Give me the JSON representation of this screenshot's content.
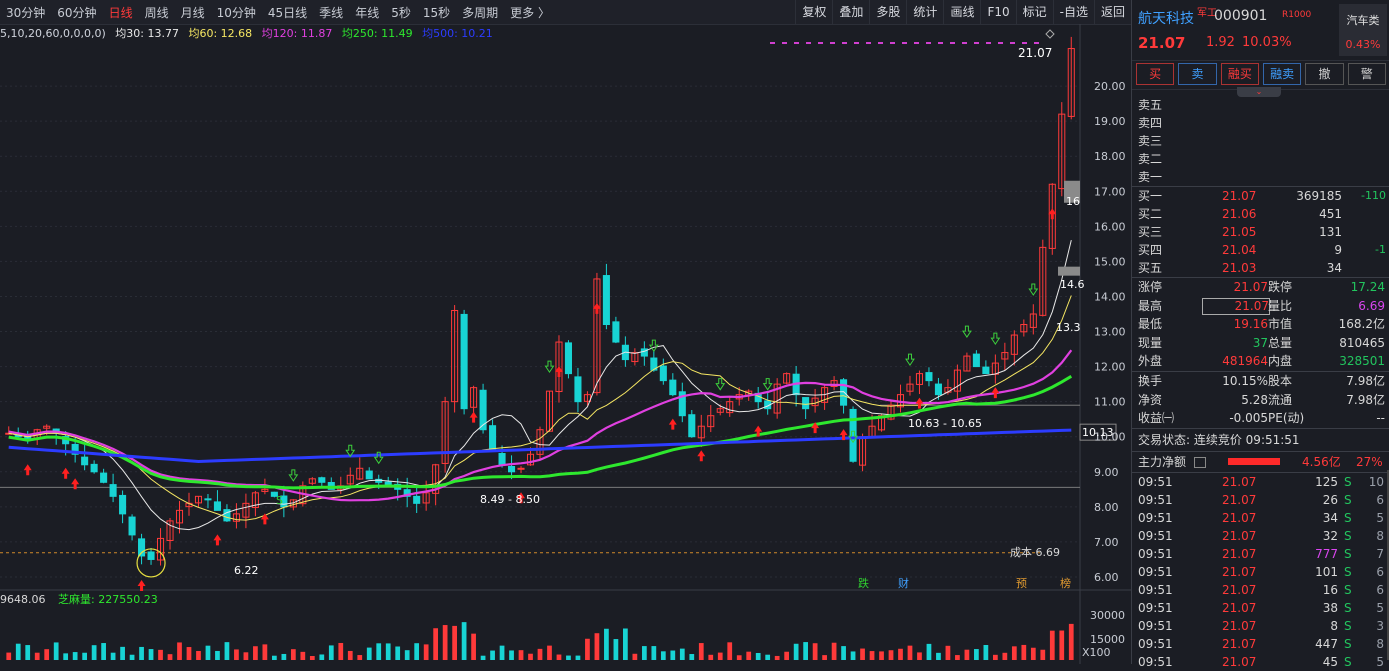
{
  "toolbar": {
    "periods": [
      "30分钟",
      "60分钟",
      "日线",
      "周线",
      "月线",
      "10分钟",
      "45日线",
      "季线",
      "年线",
      "5秒",
      "15秒",
      "多周期",
      "更多 〉"
    ],
    "active_period": "日线",
    "tools": [
      "复权",
      "叠加",
      "多股",
      "统计",
      "画线",
      "F10",
      "标记",
      "-自选",
      "返回"
    ]
  },
  "ma_legend": {
    "params": "5,10,20,60,0,0,0,0)",
    "ma30": "均30: 13.77",
    "ma60": "均60: 12.68",
    "ma120": "均120: 11.87",
    "ma250": "均250: 11.49",
    "ma500": "均500: 10.21"
  },
  "chart_labels": {
    "top_price": "21.07",
    "right_14": "14.6",
    "right_13": "13.3",
    "right_16": "16",
    "level_label": "10.13",
    "box1": "8.49 - 8.50",
    "box2": "10.63 - 10.65",
    "low": "6.22",
    "cost": "成本 6.69",
    "event1": "跌",
    "event2": "财",
    "event3": "预",
    "event4": "榜",
    "s_mark": "S",
    "vol_left": "9648.06",
    "vol_name": "芝麻量: 227550.23",
    "vol_30000": "30000",
    "vol_15000": "15000",
    "vol_x100": "X100"
  },
  "y_axis": [
    "20.00",
    "19.00",
    "18.00",
    "17.00",
    "16.00",
    "15.00",
    "14.00",
    "13.00",
    "12.00",
    "11.00",
    "10.00",
    "9.00",
    "8.00",
    "7.00",
    "6.00"
  ],
  "stock": {
    "name": "航天科技",
    "tag": "军工",
    "code": "000901",
    "mark": "R",
    "mark2": "1000",
    "price": "21.07",
    "change": "1.92",
    "pct": "10.03%",
    "sector": "汽车类",
    "sector_pct": "0.43%"
  },
  "trade_buttons": [
    "买",
    "卖",
    "融买",
    "融卖",
    "撤",
    "警"
  ],
  "expand_icon": "chevron-down-icon",
  "asks": [
    "卖五",
    "卖四",
    "卖三",
    "卖二",
    "卖一"
  ],
  "bids": [
    {
      "label": "买一",
      "price": "21.07",
      "vol": "369185",
      "delta": "-110"
    },
    {
      "label": "买二",
      "price": "21.06",
      "vol": "451",
      "delta": ""
    },
    {
      "label": "买三",
      "price": "21.05",
      "vol": "131",
      "delta": ""
    },
    {
      "label": "买四",
      "price": "21.04",
      "vol": "9",
      "delta": "-1"
    },
    {
      "label": "买五",
      "price": "21.03",
      "vol": "34",
      "delta": ""
    }
  ],
  "stats1": [
    {
      "k1": "涨停",
      "v1": "21.07",
      "c1": "#ff3a3a",
      "k2": "跌停",
      "v2": "17.24",
      "c2": "#22c55e"
    },
    {
      "k1": "最高",
      "v1": "21.07",
      "c1": "#ff3a3a",
      "k2": "量比",
      "v2": "6.69",
      "c2": "#d946ef"
    },
    {
      "k1": "最低",
      "v1": "19.16",
      "c1": "#ff3a3a",
      "k2": "市值",
      "v2": "168.2亿",
      "c2": "#d8d8d8"
    },
    {
      "k1": "现量",
      "v1": "37",
      "c1": "#22c55e",
      "k2": "总量",
      "v2": "810465",
      "c2": "#d8d8d8"
    },
    {
      "k1": "外盘",
      "v1": "481964",
      "c1": "#ff3a3a",
      "k2": "内盘",
      "v2": "328501",
      "c2": "#22c55e"
    }
  ],
  "stats2": [
    {
      "k1": "换手",
      "v1": "10.15%",
      "c1": "#d8d8d8",
      "k2": "股本",
      "v2": "7.98亿",
      "c2": "#d8d8d8"
    },
    {
      "k1": "净资",
      "v1": "5.28",
      "c1": "#d8d8d8",
      "k2": "流通",
      "v2": "7.98亿",
      "c2": "#d8d8d8"
    },
    {
      "k1": "收益㈠",
      "v1": "-0.005",
      "c1": "#d8d8d8",
      "k2": "PE(动)",
      "v2": "--",
      "c2": "#d8d8d8"
    }
  ],
  "trade_status": "交易状态: 连续竞价 09:51:51",
  "main_flow": {
    "label": "主力净额",
    "value": "4.56亿",
    "pct": "27%"
  },
  "ticks": [
    {
      "t": "09:51",
      "p": "21.07",
      "v": "125",
      "s": "S",
      "n": "10",
      "vc": "#d8d8d8"
    },
    {
      "t": "09:51",
      "p": "21.07",
      "v": "26",
      "s": "S",
      "n": "6",
      "vc": "#d8d8d8"
    },
    {
      "t": "09:51",
      "p": "21.07",
      "v": "34",
      "s": "S",
      "n": "5",
      "vc": "#d8d8d8"
    },
    {
      "t": "09:51",
      "p": "21.07",
      "v": "32",
      "s": "S",
      "n": "8",
      "vc": "#d8d8d8"
    },
    {
      "t": "09:51",
      "p": "21.07",
      "v": "777",
      "s": "S",
      "n": "7",
      "vc": "#d946ef"
    },
    {
      "t": "09:51",
      "p": "21.07",
      "v": "101",
      "s": "S",
      "n": "6",
      "vc": "#d8d8d8"
    },
    {
      "t": "09:51",
      "p": "21.07",
      "v": "16",
      "s": "S",
      "n": "6",
      "vc": "#d8d8d8"
    },
    {
      "t": "09:51",
      "p": "21.07",
      "v": "38",
      "s": "S",
      "n": "5",
      "vc": "#d8d8d8"
    },
    {
      "t": "09:51",
      "p": "21.07",
      "v": "8",
      "s": "S",
      "n": "3",
      "vc": "#d8d8d8"
    },
    {
      "t": "09:51",
      "p": "21.07",
      "v": "447",
      "s": "S",
      "n": "8",
      "vc": "#d8d8d8"
    },
    {
      "t": "09:51",
      "p": "21.07",
      "v": "45",
      "s": "S",
      "n": "5",
      "vc": "#d8d8d8"
    }
  ],
  "chart_data": {
    "type": "candlestick",
    "ylim": [
      5.8,
      21.2
    ],
    "y_ticks": [
      6,
      7,
      8,
      9,
      10,
      11,
      12,
      13,
      14,
      15,
      16,
      17,
      18,
      19,
      20
    ],
    "close_path": [
      10.1,
      10.0,
      9.9,
      10.2,
      10.3,
      10.1,
      9.8,
      9.5,
      9.2,
      9.0,
      8.7,
      8.3,
      7.8,
      7.2,
      6.6,
      6.5,
      7.1,
      7.6,
      7.9,
      8.1,
      8.3,
      8.2,
      7.9,
      7.6,
      7.8,
      8.1,
      8.4,
      8.5,
      8.3,
      8.0,
      8.2,
      8.6,
      8.8,
      8.7,
      8.5,
      8.6,
      8.9,
      9.1,
      8.8,
      8.7,
      8.6,
      8.5,
      8.3,
      8.1,
      8.4,
      9.2,
      11.0,
      13.6,
      10.8,
      11.4,
      10.2,
      9.6,
      9.2,
      9.0,
      9.1,
      9.5,
      10.2,
      11.3,
      12.7,
      11.8,
      11.0,
      11.2,
      14.5,
      13.2,
      12.7,
      12.2,
      12.4,
      12.3,
      11.9,
      11.6,
      11.2,
      10.6,
      10.0,
      10.3,
      10.6,
      10.8,
      11.0,
      11.2,
      11.3,
      11.0,
      10.8,
      11.5,
      11.8,
      11.2,
      10.8,
      11.1,
      11.4,
      11.6,
      10.9,
      9.3,
      10.0,
      10.3,
      10.6,
      10.9,
      11.2,
      11.5,
      11.8,
      11.6,
      11.2,
      11.4,
      11.9,
      12.3,
      12.0,
      11.8,
      12.1,
      12.4,
      12.9,
      13.2,
      13.5,
      15.4,
      17.2,
      19.2,
      21.07
    ],
    "series": [
      {
        "name": "均60",
        "values": [
          12.68
        ]
      },
      {
        "name": "均120",
        "values": [
          11.87
        ]
      },
      {
        "name": "均250",
        "values": [
          11.49
        ]
      },
      {
        "name": "均500",
        "values": [
          10.21
        ]
      }
    ]
  }
}
